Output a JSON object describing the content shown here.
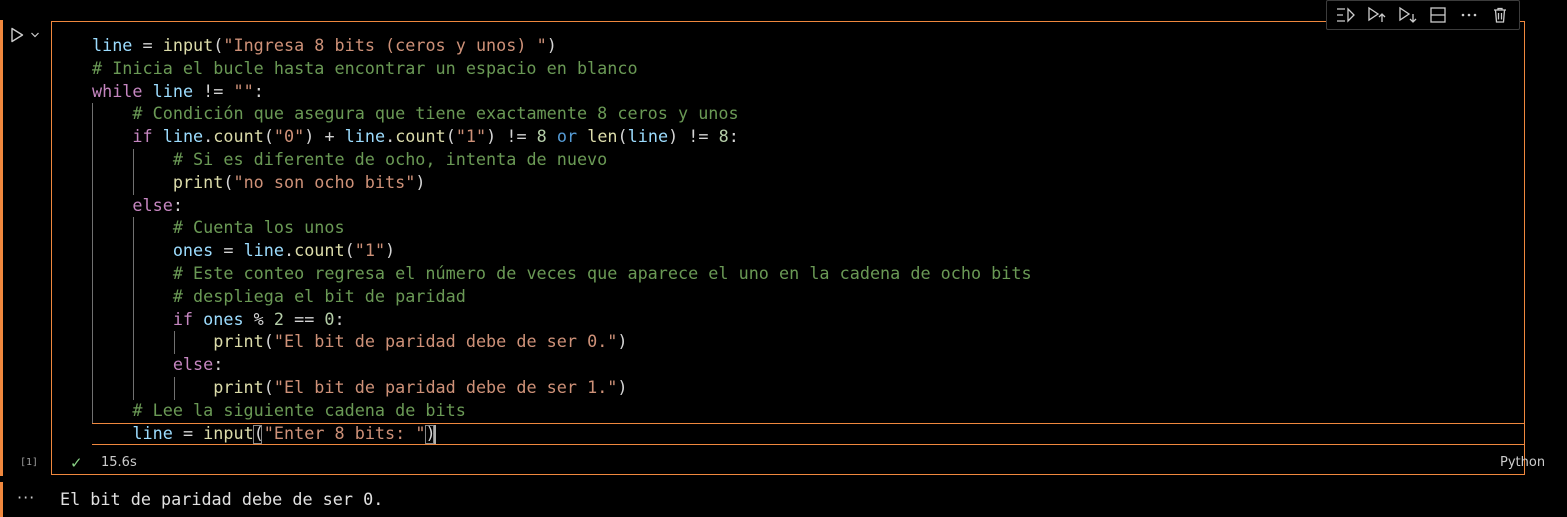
{
  "cell": {
    "execution_count": "[1]",
    "status_icon": "check-icon",
    "duration": "15.6s",
    "language": "Python",
    "toolbar": [
      {
        "name": "execute-above-icon",
        "title": "Execute Above Cells"
      },
      {
        "name": "execute-cell-and-below-icon",
        "title": "Execute Cell and Below"
      },
      {
        "name": "execute-and-below-icon",
        "title": "Execute Cell and Below"
      },
      {
        "name": "split-cell-icon",
        "title": "Split Cell"
      },
      {
        "name": "more-actions-icon",
        "title": "More Actions"
      },
      {
        "name": "delete-cell-icon",
        "title": "Delete Cell"
      }
    ]
  },
  "code": {
    "lines": [
      [
        [
          "var",
          "line"
        ],
        [
          "op",
          " = "
        ],
        [
          "fn",
          "input"
        ],
        [
          "op",
          "("
        ],
        [
          "str",
          "\"Ingresa 8 bits (ceros y unos) \""
        ],
        [
          "op",
          ")"
        ]
      ],
      [
        [
          "cm",
          "# Inicia el bucle hasta encontrar un espacio en blanco"
        ]
      ],
      [
        [
          "kw",
          "while"
        ],
        [
          "op",
          " "
        ],
        [
          "var",
          "line"
        ],
        [
          "op",
          " != "
        ],
        [
          "str",
          "\"\""
        ],
        [
          "op",
          ":"
        ]
      ],
      [
        [
          "op",
          "    "
        ],
        [
          "cm",
          "# Condición que asegura que tiene exactamente 8 ceros y unos"
        ]
      ],
      [
        [
          "op",
          "    "
        ],
        [
          "kw",
          "if"
        ],
        [
          "op",
          " "
        ],
        [
          "var",
          "line"
        ],
        [
          "op",
          "."
        ],
        [
          "fn",
          "count"
        ],
        [
          "op",
          "("
        ],
        [
          "str",
          "\"0\""
        ],
        [
          "op",
          ") + "
        ],
        [
          "var",
          "line"
        ],
        [
          "op",
          "."
        ],
        [
          "fn",
          "count"
        ],
        [
          "op",
          "("
        ],
        [
          "str",
          "\"1\""
        ],
        [
          "op",
          ") != "
        ],
        [
          "num",
          "8"
        ],
        [
          "op",
          " "
        ],
        [
          "kb",
          "or"
        ],
        [
          "op",
          " "
        ],
        [
          "fn",
          "len"
        ],
        [
          "op",
          "("
        ],
        [
          "var",
          "line"
        ],
        [
          "op",
          ") != "
        ],
        [
          "num",
          "8"
        ],
        [
          "op",
          ":"
        ]
      ],
      [
        [
          "op",
          "        "
        ],
        [
          "cm",
          "# Si es diferente de ocho, intenta de nuevo"
        ]
      ],
      [
        [
          "op",
          "        "
        ],
        [
          "fn",
          "print"
        ],
        [
          "op",
          "("
        ],
        [
          "str",
          "\"no son ocho bits\""
        ],
        [
          "op",
          ")"
        ]
      ],
      [
        [
          "op",
          "    "
        ],
        [
          "kw",
          "else"
        ],
        [
          "op",
          ":"
        ]
      ],
      [
        [
          "op",
          "        "
        ],
        [
          "cm",
          "# Cuenta los unos"
        ]
      ],
      [
        [
          "op",
          "        "
        ],
        [
          "var",
          "ones"
        ],
        [
          "op",
          " = "
        ],
        [
          "var",
          "line"
        ],
        [
          "op",
          "."
        ],
        [
          "fn",
          "count"
        ],
        [
          "op",
          "("
        ],
        [
          "str",
          "\"1\""
        ],
        [
          "op",
          ")"
        ]
      ],
      [
        [
          "op",
          "        "
        ],
        [
          "cm",
          "# Este conteo regresa el número de veces que aparece el uno en la cadena de ocho bits"
        ]
      ],
      [
        [
          "op",
          "        "
        ],
        [
          "cm",
          "# despliega el bit de paridad"
        ]
      ],
      [
        [
          "op",
          "        "
        ],
        [
          "kw",
          "if"
        ],
        [
          "op",
          " "
        ],
        [
          "var",
          "ones"
        ],
        [
          "op",
          " % "
        ],
        [
          "num",
          "2"
        ],
        [
          "op",
          " == "
        ],
        [
          "num",
          "0"
        ],
        [
          "op",
          ":"
        ]
      ],
      [
        [
          "op",
          "            "
        ],
        [
          "fn",
          "print"
        ],
        [
          "op",
          "("
        ],
        [
          "str",
          "\"El bit de paridad debe de ser 0.\""
        ],
        [
          "op",
          ")"
        ]
      ],
      [
        [
          "op",
          "        "
        ],
        [
          "kw",
          "else"
        ],
        [
          "op",
          ":"
        ]
      ],
      [
        [
          "op",
          "            "
        ],
        [
          "fn",
          "print"
        ],
        [
          "op",
          "("
        ],
        [
          "str",
          "\"El bit de paridad debe de ser 1.\""
        ],
        [
          "op",
          ")"
        ]
      ],
      [
        [
          "op",
          "    "
        ],
        [
          "cm",
          "# Lee la siguiente cadena de bits"
        ]
      ],
      [
        [
          "op",
          "    "
        ],
        [
          "var",
          "line"
        ],
        [
          "op",
          " = "
        ],
        [
          "fn",
          "input"
        ],
        [
          "op",
          "("
        ],
        [
          "str",
          "\"Enter 8 bits: \""
        ],
        [
          "op",
          ")"
        ]
      ]
    ]
  },
  "output": {
    "ellipsis": "···",
    "text": "El bit de paridad debe de ser 0."
  },
  "colors": {
    "accent_focus": "#f0883e",
    "success": "#89d185",
    "comment": "#6a9955",
    "string": "#ce9178",
    "keyword": "#c586c0",
    "variable": "#9cdcfe",
    "function": "#dcdcaa"
  }
}
